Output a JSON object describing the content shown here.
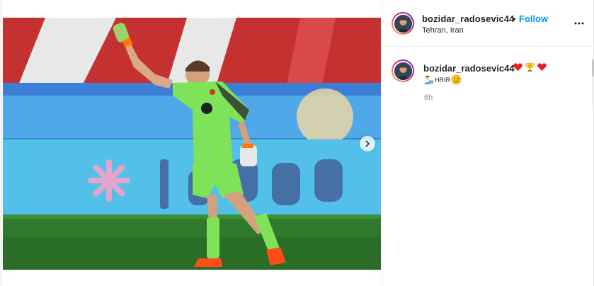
{
  "post": {
    "author": {
      "username": "bozidar_radosevic44",
      "separator": "•",
      "follow_label": "Follow",
      "location": "Tehran, Iran"
    },
    "menu_icon": "more-horizontal-icon",
    "photo": {
      "description_icon": "goalkeeper-photo",
      "next_icon": "chevron-right-icon",
      "carousel_count": 2,
      "carousel_active": 0
    },
    "caption": {
      "username": "bozidar_radosevic44",
      "emojis": [
        "red-heart-icon",
        "trophy-icon",
        "red-heart-icon"
      ],
      "text": "HRIR",
      "leading_emoji": "person-with-laptop-icon",
      "trailing_emoji": "winking-face-icon",
      "time": "6h"
    }
  },
  "colors": {
    "link": "#0095f6",
    "text": "#262626",
    "muted": "#8e8e8e",
    "jersey": "#7fe35a",
    "sky_banner": "#3fa9e6",
    "pitch": "#2f7a2c"
  }
}
